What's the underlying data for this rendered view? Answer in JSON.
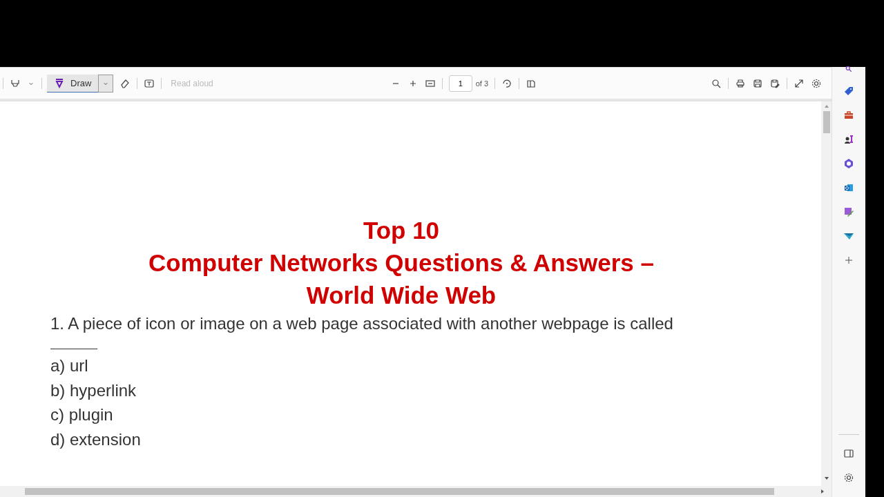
{
  "toolbar": {
    "draw_button": {
      "label": "Draw",
      "selected": true
    },
    "read_aloud": {
      "label": "Read aloud",
      "disabled": true
    },
    "page_number": "1",
    "page_total": "of 3"
  },
  "document": {
    "title_lines": [
      "Top 10",
      "Computer Networks Questions & Answers –",
      "World Wide Web"
    ],
    "question": "1. A piece of icon or image on a web page associated with another webpage is called",
    "options": [
      "a) url",
      "b) hyperlink",
      "c) plugin",
      "d) extension"
    ]
  }
}
